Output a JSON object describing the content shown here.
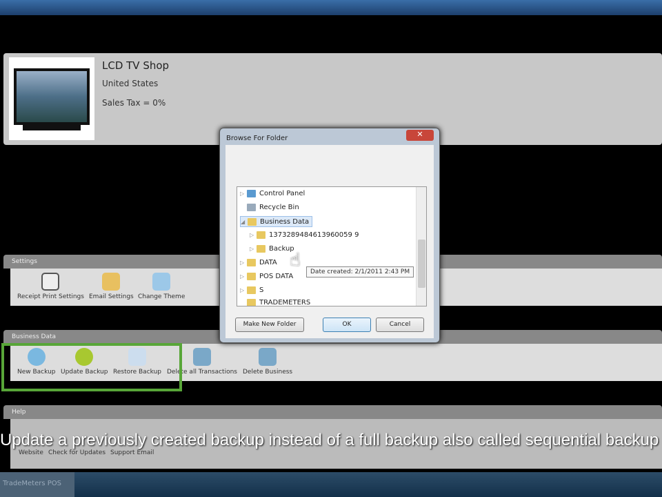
{
  "store": {
    "name": "LCD TV Shop",
    "country": "United States",
    "tax": "Sales Tax = 0%"
  },
  "settings": {
    "title": "Settings",
    "items": [
      "Receipt Print Settings",
      "Email Settings",
      "Change Theme"
    ]
  },
  "business": {
    "title": "Business Data",
    "items": [
      "New Backup",
      "Update Backup",
      "Restore Backup",
      "Delete all Transactions",
      "Delete Business"
    ]
  },
  "help": {
    "title": "Help",
    "items": [
      "Website",
      "Check for Updates",
      "Support Email"
    ]
  },
  "dialog": {
    "title": "Browse For Folder",
    "close": "✕",
    "tree": [
      "Control Panel",
      "Recycle Bin",
      "Business Data",
      "1373289484613960059 9",
      "Backup",
      "DATA",
      "POS DATA",
      "S",
      "TRADEMETERS"
    ],
    "tooltip": "Date created: 2/1/2011 2:43 PM",
    "new_folder": "Make New Folder",
    "ok": "OK",
    "cancel": "Cancel"
  },
  "caption": "Update a previously created backup instead of a full backup also called sequential backup",
  "taskbar": {
    "app": "TradeMeters POS"
  },
  "colors": {
    "highlight": "#58a638"
  }
}
